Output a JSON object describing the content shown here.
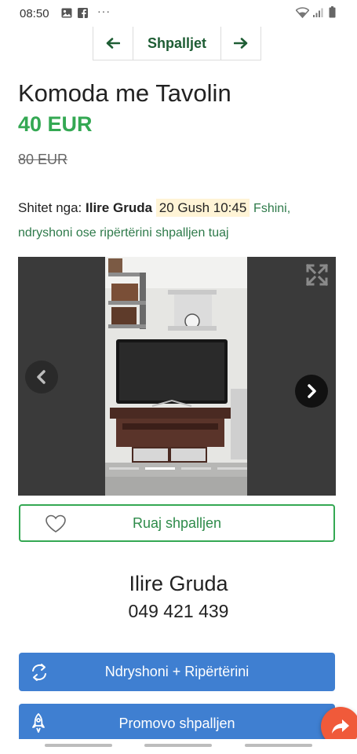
{
  "status_bar": {
    "time": "08:50",
    "more": "···",
    "icons": [
      "gallery-icon",
      "facebook-icon",
      "wifi-icon",
      "signal-icon",
      "battery-icon"
    ]
  },
  "nav": {
    "title": "Shpalljet",
    "prev_icon": "arrow-left-icon",
    "next_icon": "arrow-right-icon"
  },
  "listing": {
    "title": "Komoda me Tavolin",
    "price": "40 EUR",
    "old_price": "80 EUR"
  },
  "seller_line": {
    "prefix": "Shitet nga:",
    "seller": "Ilire Gruda",
    "date": "20 Gush 10:45",
    "edit_link": "Fshini, ndryshoni ose ripërtërini shpalljen tuaj"
  },
  "gallery": {
    "slide_count": 4,
    "active_slide": 2
  },
  "save_button": {
    "label": "Ruaj shpalljen"
  },
  "contact": {
    "name": "Ilire Gruda",
    "phone": "049 421 439"
  },
  "actions": {
    "renew_label": "Ndryshoni + Ripërtërini",
    "promote_label": "Promovo shpalljen"
  },
  "colors": {
    "accent_green": "#34a853",
    "nav_green": "#1e5d34",
    "button_blue": "#3f7fd1",
    "share_orange": "#f05a3a",
    "date_highlight": "#fff4d6"
  }
}
